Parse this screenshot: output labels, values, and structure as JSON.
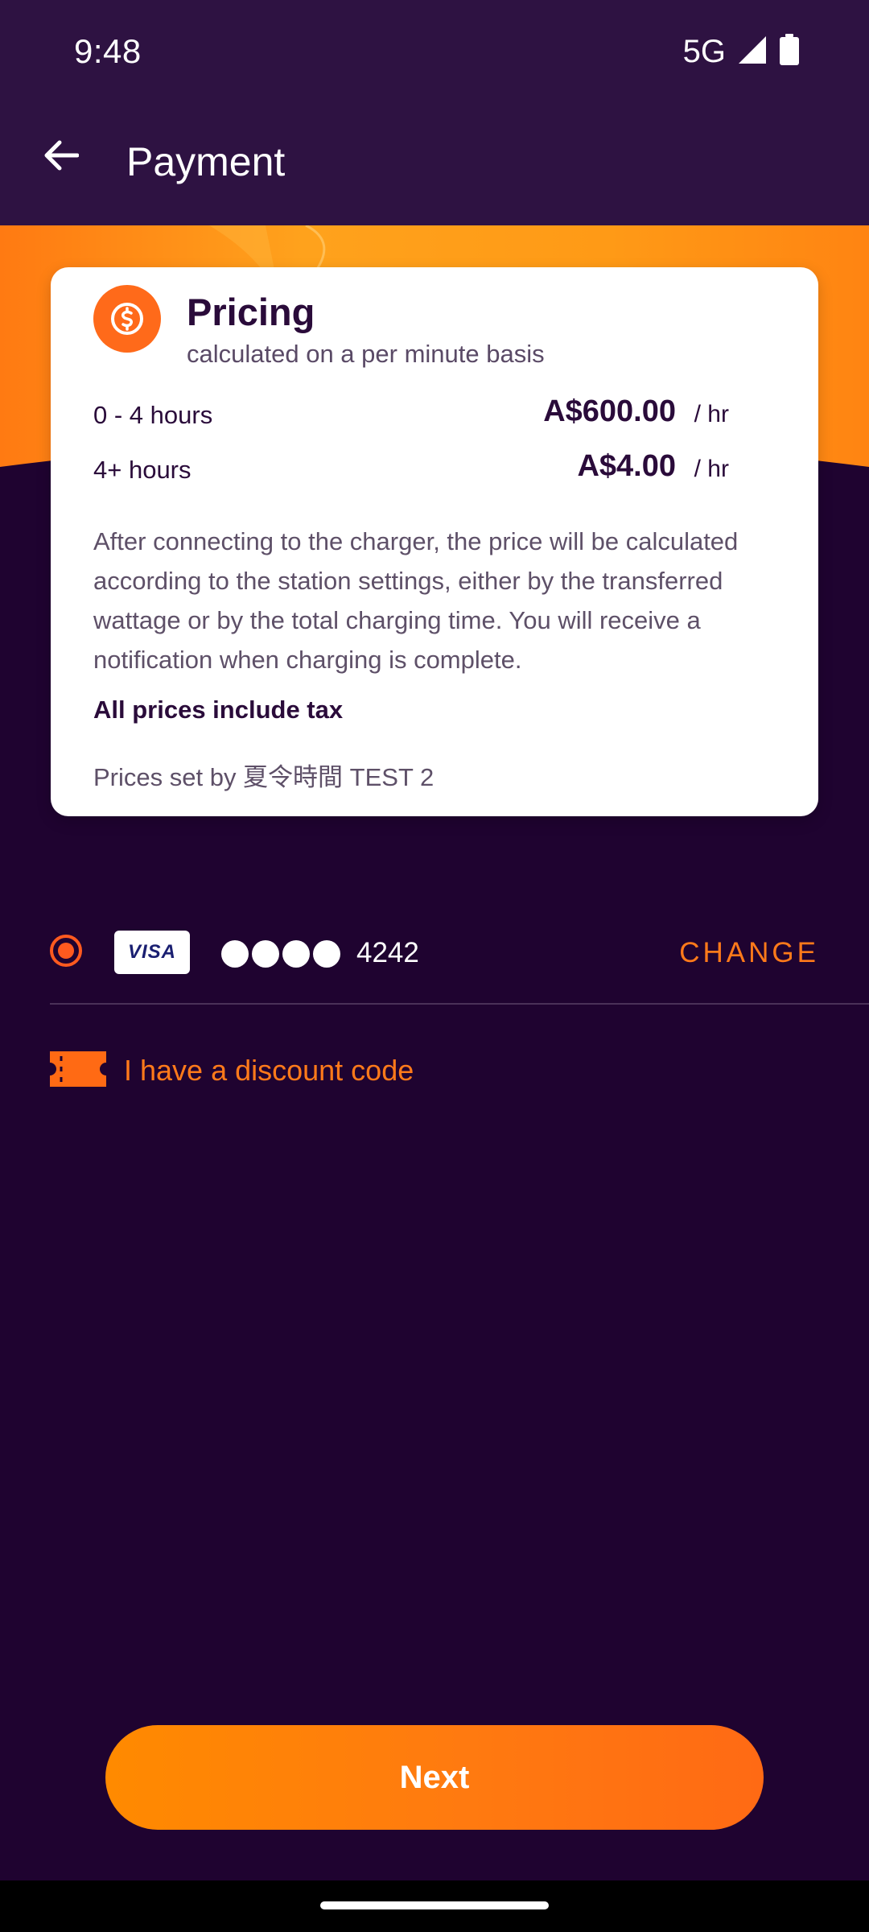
{
  "status_bar": {
    "time": "9:48",
    "network": "5G"
  },
  "app_bar": {
    "title": "Payment",
    "back_icon": "arrow-left-icon"
  },
  "pricing": {
    "icon": "dollar-coin-icon",
    "title": "Pricing",
    "subtitle": "calculated on a per minute basis",
    "rows": [
      {
        "label": "0 - 4 hours",
        "amount": "A$600.00",
        "unit": "/ hr"
      },
      {
        "label": "4+ hours",
        "amount": "A$4.00",
        "unit": "/ hr"
      }
    ],
    "description": "After connecting to the charger, the price will be calculated according to the station settings, either by the transferred wattage or by the total charging time. You will receive a notification when charging is complete.",
    "tax_note": "All prices include tax",
    "prices_set_by": "Prices set by 夏令時間 TEST 2"
  },
  "payment_method": {
    "selected": true,
    "brand": "VISA",
    "masked_dots": 4,
    "last4": "4242",
    "change_label": "CHANGE"
  },
  "discount": {
    "icon": "ticket-icon",
    "label": "I have a discount code"
  },
  "next_button": {
    "label": "Next"
  },
  "colors": {
    "background": "#1f0330",
    "header": "#2e1242",
    "accent": "#ff7a1a",
    "card": "#ffffff"
  }
}
